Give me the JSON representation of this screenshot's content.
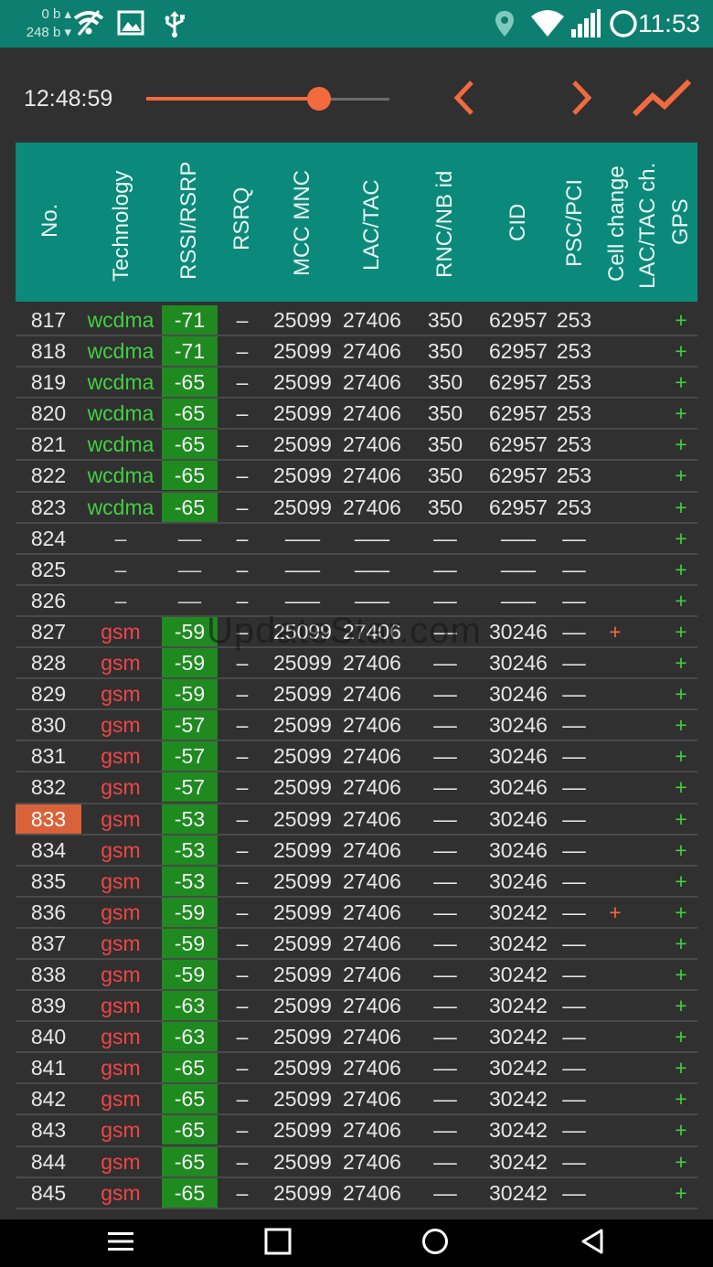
{
  "status_bar": {
    "traffic_up": "0 b",
    "traffic_down": "248 b",
    "time": "11:53",
    "icons": [
      "wifi-off-icon",
      "image-icon",
      "usb-icon",
      "location-icon",
      "wifi-icon",
      "signal-icon",
      "circle-icon"
    ]
  },
  "controls": {
    "time": "12:48:59",
    "slider_fraction": 0.71,
    "prev_icon": "chevron-left-icon",
    "next_icon": "chevron-right-icon",
    "chart_icon": "chart-line-icon",
    "accent_color": "#f26a3d"
  },
  "table": {
    "headers": [
      "No.",
      "Technology",
      "RSSI/RSRP",
      "RSRQ",
      "MCC MNC",
      "LAC/TAC",
      "RNC/NB id",
      "CID",
      "PSC/PCI",
      "Cell change",
      "LAC/TAC ch.",
      "GPS"
    ],
    "rows": [
      {
        "no": "817",
        "tech": "wcdma",
        "rssi": "-71",
        "rsrq": "–",
        "mcc": "25099",
        "lac": "27406",
        "rnc": "350",
        "cid": "62957",
        "psc": "253",
        "cc": "",
        "gps": "+"
      },
      {
        "no": "818",
        "tech": "wcdma",
        "rssi": "-71",
        "rsrq": "–",
        "mcc": "25099",
        "lac": "27406",
        "rnc": "350",
        "cid": "62957",
        "psc": "253",
        "cc": "",
        "gps": "+"
      },
      {
        "no": "819",
        "tech": "wcdma",
        "rssi": "-65",
        "rsrq": "–",
        "mcc": "25099",
        "lac": "27406",
        "rnc": "350",
        "cid": "62957",
        "psc": "253",
        "cc": "",
        "gps": "+"
      },
      {
        "no": "820",
        "tech": "wcdma",
        "rssi": "-65",
        "rsrq": "–",
        "mcc": "25099",
        "lac": "27406",
        "rnc": "350",
        "cid": "62957",
        "psc": "253",
        "cc": "",
        "gps": "+"
      },
      {
        "no": "821",
        "tech": "wcdma",
        "rssi": "-65",
        "rsrq": "–",
        "mcc": "25099",
        "lac": "27406",
        "rnc": "350",
        "cid": "62957",
        "psc": "253",
        "cc": "",
        "gps": "+"
      },
      {
        "no": "822",
        "tech": "wcdma",
        "rssi": "-65",
        "rsrq": "–",
        "mcc": "25099",
        "lac": "27406",
        "rnc": "350",
        "cid": "62957",
        "psc": "253",
        "cc": "",
        "gps": "+"
      },
      {
        "no": "823",
        "tech": "wcdma",
        "rssi": "-65",
        "rsrq": "–",
        "mcc": "25099",
        "lac": "27406",
        "rnc": "350",
        "cid": "62957",
        "psc": "253",
        "cc": "",
        "gps": "+"
      },
      {
        "no": "824",
        "tech": "–",
        "rssi": "––",
        "rsrq": "–",
        "mcc": "–––",
        "lac": "–––",
        "rnc": "––",
        "cid": "–––",
        "psc": "––",
        "cc": "",
        "gps": "+"
      },
      {
        "no": "825",
        "tech": "–",
        "rssi": "––",
        "rsrq": "–",
        "mcc": "–––",
        "lac": "–––",
        "rnc": "––",
        "cid": "–––",
        "psc": "––",
        "cc": "",
        "gps": "+"
      },
      {
        "no": "826",
        "tech": "–",
        "rssi": "––",
        "rsrq": "–",
        "mcc": "–––",
        "lac": "–––",
        "rnc": "––",
        "cid": "–––",
        "psc": "––",
        "cc": "",
        "gps": "+"
      },
      {
        "no": "827",
        "tech": "gsm",
        "rssi": "-59",
        "rsrq": "–",
        "mcc": "25099",
        "lac": "27406",
        "rnc": "––",
        "cid": "30246",
        "psc": "––",
        "cc": "+",
        "gps": "+"
      },
      {
        "no": "828",
        "tech": "gsm",
        "rssi": "-59",
        "rsrq": "–",
        "mcc": "25099",
        "lac": "27406",
        "rnc": "––",
        "cid": "30246",
        "psc": "––",
        "cc": "",
        "gps": "+"
      },
      {
        "no": "829",
        "tech": "gsm",
        "rssi": "-59",
        "rsrq": "–",
        "mcc": "25099",
        "lac": "27406",
        "rnc": "––",
        "cid": "30246",
        "psc": "––",
        "cc": "",
        "gps": "+"
      },
      {
        "no": "830",
        "tech": "gsm",
        "rssi": "-57",
        "rsrq": "–",
        "mcc": "25099",
        "lac": "27406",
        "rnc": "––",
        "cid": "30246",
        "psc": "––",
        "cc": "",
        "gps": "+"
      },
      {
        "no": "831",
        "tech": "gsm",
        "rssi": "-57",
        "rsrq": "–",
        "mcc": "25099",
        "lac": "27406",
        "rnc": "––",
        "cid": "30246",
        "psc": "––",
        "cc": "",
        "gps": "+"
      },
      {
        "no": "832",
        "tech": "gsm",
        "rssi": "-57",
        "rsrq": "–",
        "mcc": "25099",
        "lac": "27406",
        "rnc": "––",
        "cid": "30246",
        "psc": "––",
        "cc": "",
        "gps": "+"
      },
      {
        "no": "833",
        "tech": "gsm",
        "rssi": "-53",
        "rsrq": "–",
        "mcc": "25099",
        "lac": "27406",
        "rnc": "––",
        "cid": "30246",
        "psc": "––",
        "cc": "",
        "gps": "+",
        "selected": true
      },
      {
        "no": "834",
        "tech": "gsm",
        "rssi": "-53",
        "rsrq": "–",
        "mcc": "25099",
        "lac": "27406",
        "rnc": "––",
        "cid": "30246",
        "psc": "––",
        "cc": "",
        "gps": "+"
      },
      {
        "no": "835",
        "tech": "gsm",
        "rssi": "-53",
        "rsrq": "–",
        "mcc": "25099",
        "lac": "27406",
        "rnc": "––",
        "cid": "30246",
        "psc": "––",
        "cc": "",
        "gps": "+"
      },
      {
        "no": "836",
        "tech": "gsm",
        "rssi": "-59",
        "rsrq": "–",
        "mcc": "25099",
        "lac": "27406",
        "rnc": "––",
        "cid": "30242",
        "psc": "––",
        "cc": "+",
        "gps": "+"
      },
      {
        "no": "837",
        "tech": "gsm",
        "rssi": "-59",
        "rsrq": "–",
        "mcc": "25099",
        "lac": "27406",
        "rnc": "––",
        "cid": "30242",
        "psc": "––",
        "cc": "",
        "gps": "+"
      },
      {
        "no": "838",
        "tech": "gsm",
        "rssi": "-59",
        "rsrq": "–",
        "mcc": "25099",
        "lac": "27406",
        "rnc": "––",
        "cid": "30242",
        "psc": "––",
        "cc": "",
        "gps": "+"
      },
      {
        "no": "839",
        "tech": "gsm",
        "rssi": "-63",
        "rsrq": "–",
        "mcc": "25099",
        "lac": "27406",
        "rnc": "––",
        "cid": "30242",
        "psc": "––",
        "cc": "",
        "gps": "+"
      },
      {
        "no": "840",
        "tech": "gsm",
        "rssi": "-63",
        "rsrq": "–",
        "mcc": "25099",
        "lac": "27406",
        "rnc": "––",
        "cid": "30242",
        "psc": "––",
        "cc": "",
        "gps": "+"
      },
      {
        "no": "841",
        "tech": "gsm",
        "rssi": "-65",
        "rsrq": "–",
        "mcc": "25099",
        "lac": "27406",
        "rnc": "––",
        "cid": "30242",
        "psc": "––",
        "cc": "",
        "gps": "+"
      },
      {
        "no": "842",
        "tech": "gsm",
        "rssi": "-65",
        "rsrq": "–",
        "mcc": "25099",
        "lac": "27406",
        "rnc": "––",
        "cid": "30242",
        "psc": "––",
        "cc": "",
        "gps": "+"
      },
      {
        "no": "843",
        "tech": "gsm",
        "rssi": "-65",
        "rsrq": "–",
        "mcc": "25099",
        "lac": "27406",
        "rnc": "––",
        "cid": "30242",
        "psc": "––",
        "cc": "",
        "gps": "+"
      },
      {
        "no": "844",
        "tech": "gsm",
        "rssi": "-65",
        "rsrq": "–",
        "mcc": "25099",
        "lac": "27406",
        "rnc": "––",
        "cid": "30242",
        "psc": "––",
        "cc": "",
        "gps": "+"
      },
      {
        "no": "845",
        "tech": "gsm",
        "rssi": "-65",
        "rsrq": "–",
        "mcc": "25099",
        "lac": "27406",
        "rnc": "––",
        "cid": "30242",
        "psc": "––",
        "cc": "",
        "gps": "+"
      }
    ]
  },
  "watermark": "UpdateStar.com",
  "nav_bar": {
    "icons": [
      "menu-icon",
      "recents-square-icon",
      "home-circle-icon",
      "back-triangle-icon"
    ]
  }
}
